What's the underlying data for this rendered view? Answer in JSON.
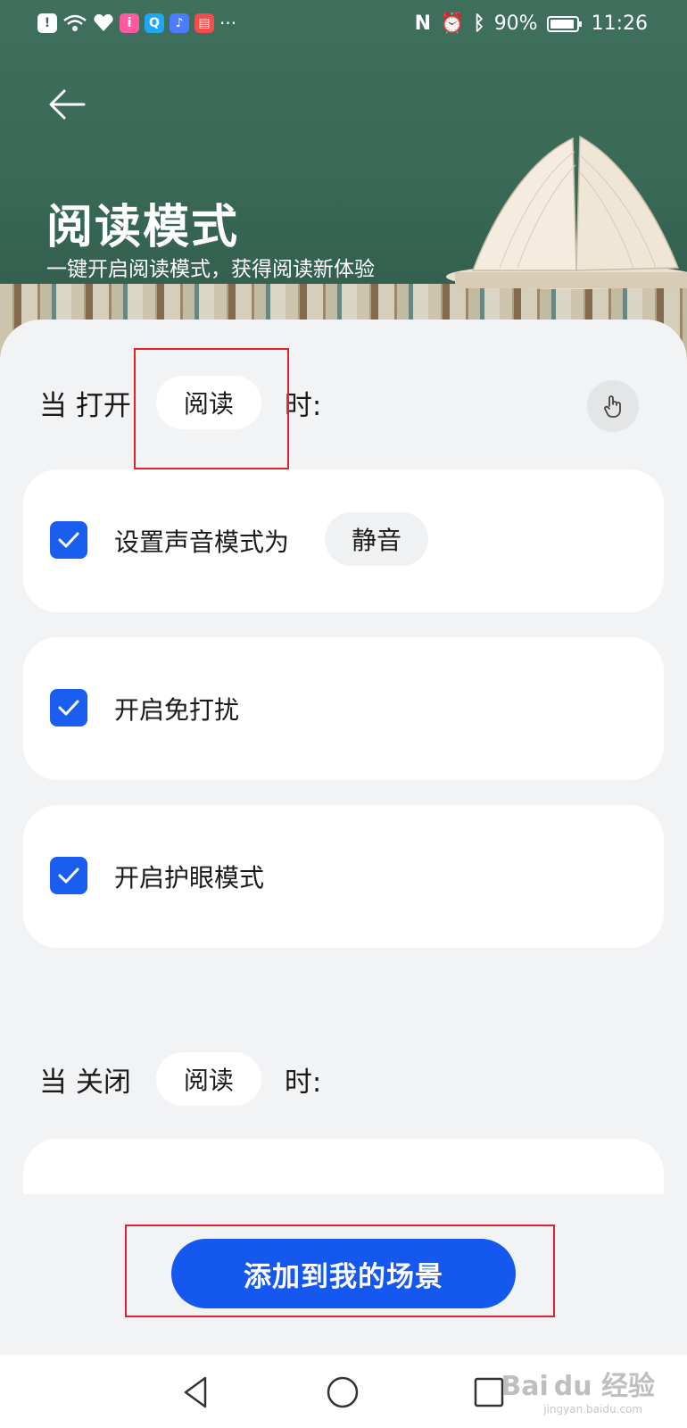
{
  "status_bar": {
    "battery": "90%",
    "time": "11:26",
    "overflow": "···"
  },
  "header": {
    "title": "阅读模式",
    "subtitle": "一键开启阅读模式，获得阅读新体验"
  },
  "open_condition": {
    "prefix": "当 打开",
    "app": "阅读",
    "suffix": "时:"
  },
  "actions": [
    {
      "label": "设置声音模式为",
      "value": "静音",
      "checked": true
    },
    {
      "label": "开启免打扰",
      "checked": true
    },
    {
      "label": "开启护眼模式",
      "checked": true
    }
  ],
  "close_condition": {
    "prefix": "当 关闭",
    "app": "阅读",
    "suffix": "时:"
  },
  "add_button": "添加到我的场景",
  "watermark": {
    "text": "Bai du 经验",
    "url_text": "jingyan.baidu.com"
  },
  "colors": {
    "accent": "#1458f0",
    "checkbox": "#1a5ef0",
    "highlight": "#e0242a"
  },
  "icons": [
    "back-arrow-icon",
    "touch-hand-icon",
    "checkmark-icon",
    "nav-back-icon",
    "nav-home-icon",
    "nav-recents-icon"
  ]
}
